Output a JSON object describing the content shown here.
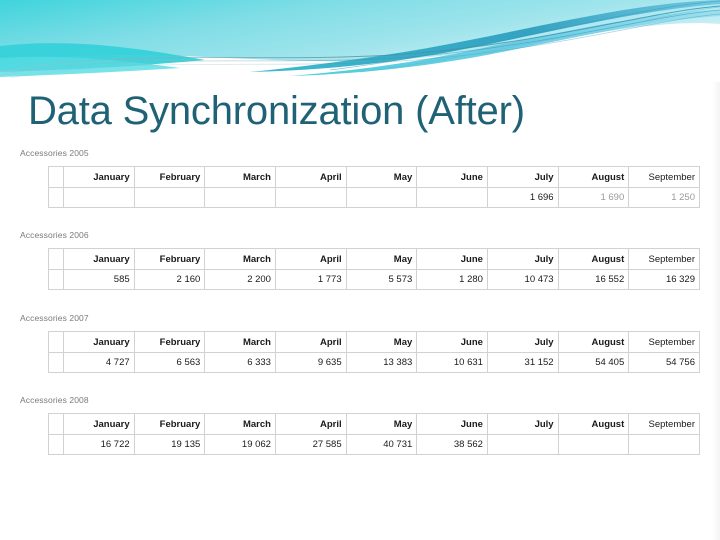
{
  "slide": {
    "title": "Data Synchronization (After)",
    "title_color": "#1F6276",
    "banner_colors": {
      "cyan": "#4FD6DE",
      "sky": "#62C6E0",
      "teal": "#2E9FBF",
      "pale": "#BEEAF0",
      "deep": "#1F7E9B"
    }
  },
  "table": {
    "columns": [
      "January",
      "February",
      "March",
      "April",
      "May",
      "June",
      "July",
      "August",
      "September"
    ],
    "blocks": [
      {
        "label": "Accessories 2005",
        "values": [
          "",
          "",
          "",
          "",
          "",
          "",
          "1 696",
          "1 690",
          "1 250"
        ],
        "faint": [
          false,
          false,
          false,
          false,
          false,
          false,
          false,
          true,
          true
        ]
      },
      {
        "label": "Accessories 2006",
        "values": [
          "585",
          "2 160",
          "2 200",
          "1 773",
          "5 573",
          "1 280",
          "10 473",
          "16 552",
          "16 329"
        ],
        "faint": [
          false,
          false,
          false,
          false,
          false,
          false,
          false,
          false,
          false
        ]
      },
      {
        "label": "Accessories 2007",
        "values": [
          "4 727",
          "6 563",
          "6 333",
          "9 635",
          "13 383",
          "10 631",
          "31 152",
          "54 405",
          "54 756"
        ],
        "faint": [
          false,
          false,
          false,
          false,
          false,
          false,
          false,
          false,
          false
        ]
      },
      {
        "label": "Accessories 2008",
        "values": [
          "16 722",
          "19 135",
          "19 062",
          "27 585",
          "40 731",
          "38 562",
          "",
          "",
          ""
        ],
        "faint": [
          false,
          false,
          false,
          false,
          false,
          false,
          false,
          false,
          false
        ]
      }
    ]
  }
}
